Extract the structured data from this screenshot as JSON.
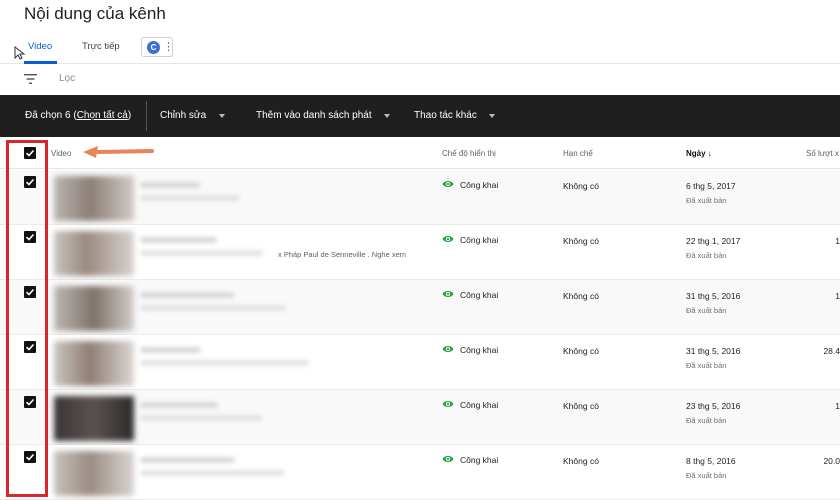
{
  "page": {
    "title": "Nội dung của kênh"
  },
  "tabs": [
    {
      "label": "Video",
      "active": true
    },
    {
      "label": "Trực tiếp",
      "active": false
    }
  ],
  "channel_chip": {
    "avatar_letter": "C",
    "menu_icon": "more-vert-icon"
  },
  "filter": {
    "icon": "filter-icon",
    "placeholder": "Lọc"
  },
  "action_bar": {
    "selected_prefix": "Đã chọn 6 (",
    "select_all": "Chọn tất cả",
    "selected_suffix": ")",
    "edit": "Chỉnh sửa",
    "add_to_playlist": "Thêm vào danh sách phát",
    "more_actions": "Thao tác khác"
  },
  "columns": {
    "video": "Video",
    "visibility": "Chế độ hiển thị",
    "restrictions": "Hạn chế",
    "date": "Ngày",
    "views": "Số lượt x"
  },
  "rows": [
    {
      "visibility": "Công khai",
      "restriction": "Không có",
      "date": "6 thg 5, 2017",
      "status": "Đã xuất bản",
      "views": "",
      "desc": ""
    },
    {
      "visibility": "Công khai",
      "restriction": "Không có",
      "date": "22 thg 1, 2017",
      "status": "Đã xuất bản",
      "views": "1",
      "desc": "x Pháp Paul de Senneville . Nghe xem"
    },
    {
      "visibility": "Công khai",
      "restriction": "Không có",
      "date": "31 thg 5, 2016",
      "status": "Đã xuất bản",
      "views": "1",
      "desc": ""
    },
    {
      "visibility": "Công khai",
      "restriction": "Không có",
      "date": "31 thg 5, 2016",
      "status": "Đã xuất bản",
      "views": "28.4",
      "desc": ""
    },
    {
      "visibility": "Công khai",
      "restriction": "Không có",
      "date": "23 thg 5, 2016",
      "status": "Đã xuất bản",
      "views": "1",
      "desc": ""
    },
    {
      "visibility": "Công khai",
      "restriction": "Không có",
      "date": "8 thg 5, 2016",
      "status": "Đã xuất bản",
      "views": "20.0",
      "desc": ""
    }
  ],
  "colors": {
    "accent_blue": "#065fd4",
    "action_bar": "#1f1f1f",
    "visibility_green": "#2ba640",
    "highlight_red": "#d9262c",
    "arrow_orange": "#e8845a"
  }
}
